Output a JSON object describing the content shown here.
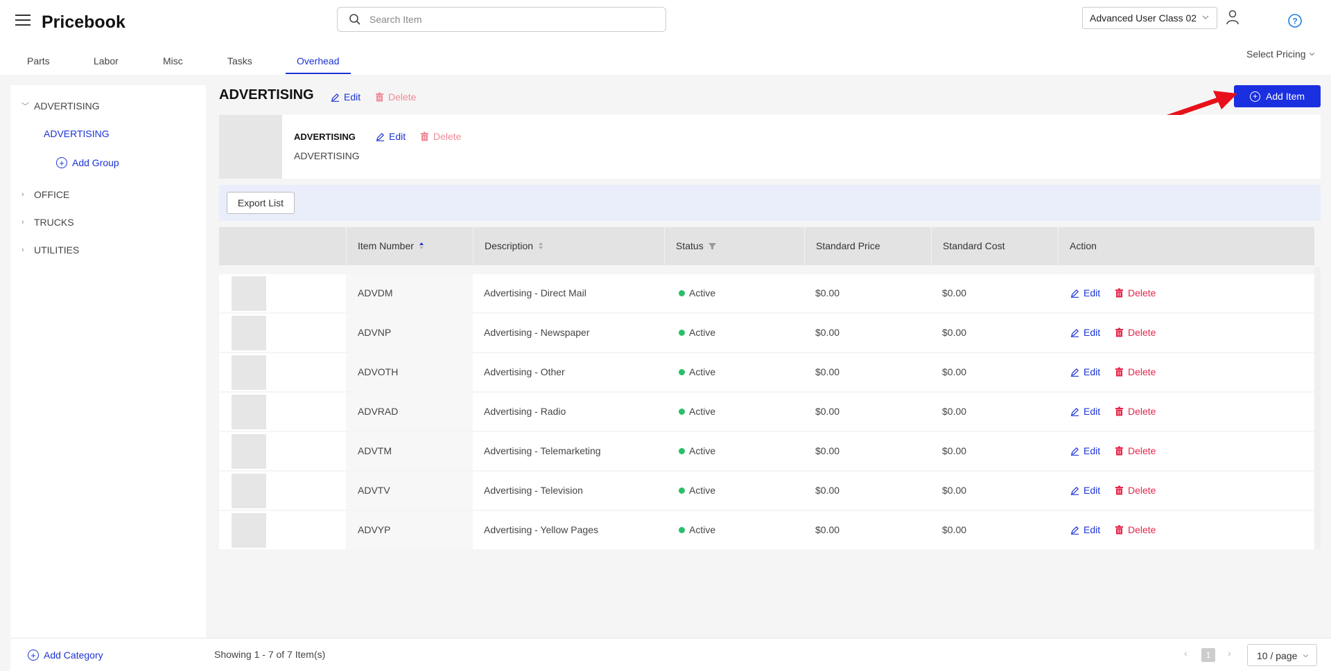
{
  "header": {
    "title": "Pricebook",
    "search_placeholder": "Search Item",
    "user_class": "Advanced User Class 02",
    "select_pricing": "Select Pricing"
  },
  "tabs": [
    {
      "label": "Parts"
    },
    {
      "label": "Labor"
    },
    {
      "label": "Misc"
    },
    {
      "label": "Tasks"
    },
    {
      "label": "Overhead",
      "active": true
    }
  ],
  "sidebar": {
    "categories": [
      {
        "label": "ADVERTISING",
        "expanded": true
      },
      {
        "label": "OFFICE"
      },
      {
        "label": "TRUCKS"
      },
      {
        "label": "UTILITIES"
      }
    ],
    "sub_group": "ADVERTISING",
    "add_group": "Add Group",
    "add_category": "Add Category"
  },
  "main": {
    "title": "ADVERTISING",
    "edit_label": "Edit",
    "delete_label": "Delete",
    "add_item": "Add Item",
    "group_card": {
      "name": "ADVERTISING",
      "description": "ADVERTISING"
    },
    "export_list": "Export List",
    "columns": {
      "item_number": "Item Number",
      "description": "Description",
      "status": "Status",
      "standard_price": "Standard Price",
      "standard_cost": "Standard Cost",
      "action": "Action"
    },
    "rows": [
      {
        "item_number": "ADVDM",
        "description": "Advertising - Direct Mail",
        "status": "Active",
        "price": "$0.00",
        "cost": "$0.00"
      },
      {
        "item_number": "ADVNP",
        "description": "Advertising - Newspaper",
        "status": "Active",
        "price": "$0.00",
        "cost": "$0.00"
      },
      {
        "item_number": "ADVOTH",
        "description": "Advertising - Other",
        "status": "Active",
        "price": "$0.00",
        "cost": "$0.00"
      },
      {
        "item_number": "ADVRAD",
        "description": "Advertising - Radio",
        "status": "Active",
        "price": "$0.00",
        "cost": "$0.00"
      },
      {
        "item_number": "ADVTM",
        "description": "Advertising - Telemarketing",
        "status": "Active",
        "price": "$0.00",
        "cost": "$0.00"
      },
      {
        "item_number": "ADVTV",
        "description": "Advertising - Television",
        "status": "Active",
        "price": "$0.00",
        "cost": "$0.00"
      },
      {
        "item_number": "ADVYP",
        "description": "Advertising - Yellow Pages",
        "status": "Active",
        "price": "$0.00",
        "cost": "$0.00"
      }
    ]
  },
  "footer": {
    "showing": "Showing 1 - 7 of 7 Item(s)",
    "current_page": "1",
    "page_size": "10 / page"
  },
  "colors": {
    "accent": "#1a33d4",
    "danger": "#e8254a",
    "active_dot": "#2bbf6a",
    "annotation_arrow": "#e8101a"
  }
}
